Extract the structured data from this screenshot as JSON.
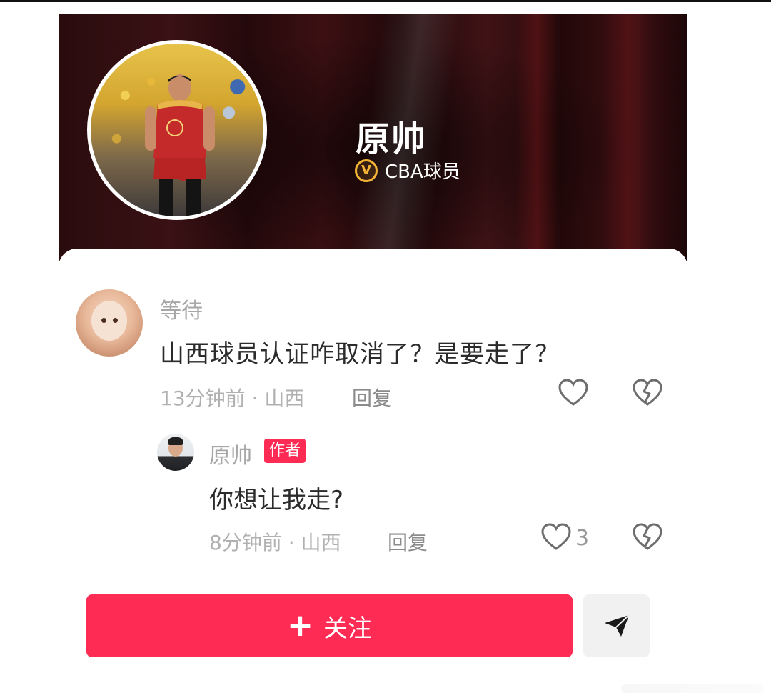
{
  "profile": {
    "name": "原帅",
    "verify_badge_letter": "V",
    "verification": "CBA球员"
  },
  "comment": {
    "username": "等待",
    "text": "山西球员认证咋取消了？是要走了？",
    "meta": "13分钟前 · 山西",
    "reply_label": "回复",
    "like_icon": "heart-outline-icon",
    "dislike_icon": "broken-heart-icon"
  },
  "reply": {
    "username": "原帅",
    "author_tag": "作者",
    "text": "你想让我走?",
    "meta": "8分钟前 · 山西",
    "reply_label": "回复",
    "like_count": "3"
  },
  "actions": {
    "follow_plus": "+",
    "follow_label": "关注",
    "share_icon": "send-icon"
  },
  "colors": {
    "accent": "#fe2c55",
    "verify_gold": "#f3b436",
    "secondary_text": "#a7a7a7"
  }
}
